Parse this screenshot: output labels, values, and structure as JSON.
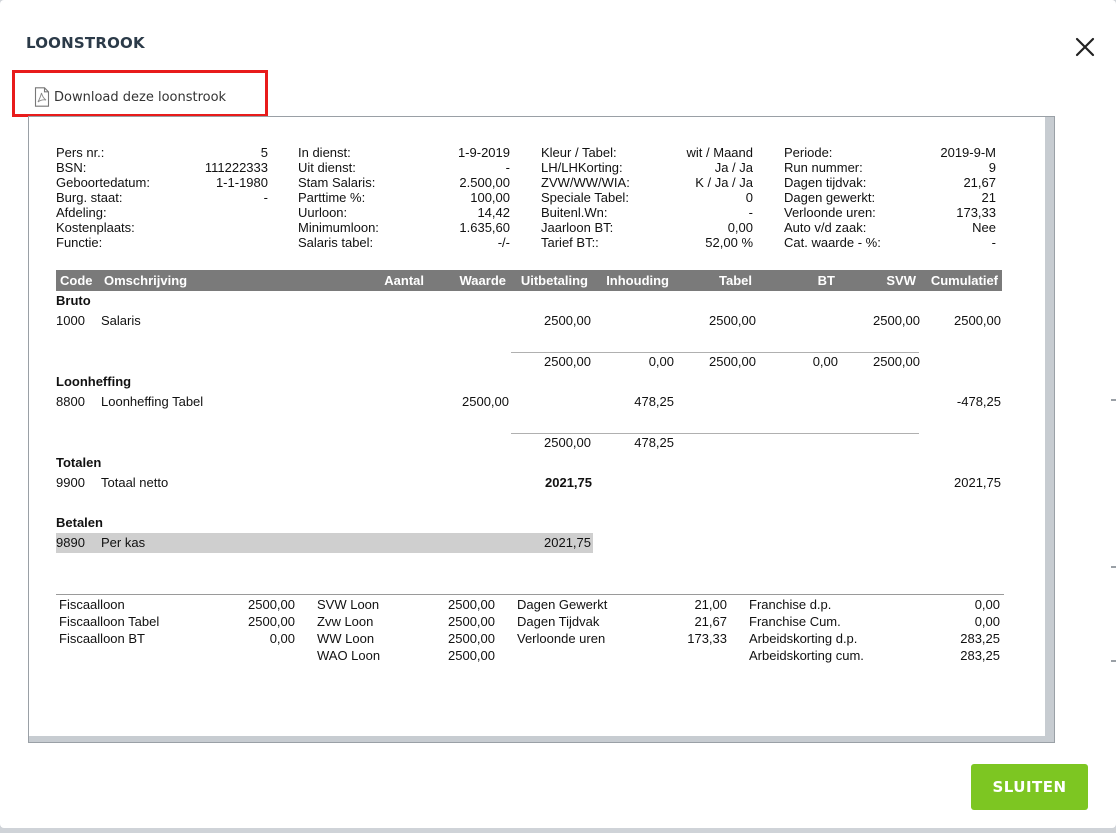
{
  "modal": {
    "title": "LOONSTROOK",
    "download_label": "Download deze loonstrook",
    "close_label": "Sluiten",
    "button_label": "SLUITEN",
    "accent_color": "#7dc622",
    "highlight_color": "#e81b1b"
  },
  "info": {
    "col1": [
      {
        "label": "Pers nr.:",
        "value": "5"
      },
      {
        "label": "BSN:",
        "value": "111222333"
      },
      {
        "label": "Geboortedatum:",
        "value": "1-1-1980"
      },
      {
        "label": "Burg. staat:",
        "value": "-"
      },
      {
        "label": "Afdeling:",
        "value": ""
      },
      {
        "label": "Kostenplaats:",
        "value": ""
      },
      {
        "label": "Functie:",
        "value": ""
      }
    ],
    "col2": [
      {
        "label": "In dienst:",
        "value": "1-9-2019"
      },
      {
        "label": "Uit dienst:",
        "value": "-"
      },
      {
        "label": "Stam Salaris:",
        "value": "2.500,00"
      },
      {
        "label": "Parttime %:",
        "value": "100,00"
      },
      {
        "label": "Uurloon:",
        "value": "14,42"
      },
      {
        "label": "Minimumloon:",
        "value": "1.635,60"
      },
      {
        "label": "Salaris tabel:",
        "value": "-/-"
      }
    ],
    "col3": [
      {
        "label": "Kleur / Tabel:",
        "value": "wit / Maand"
      },
      {
        "label": "LH/LHKorting:",
        "value": "Ja / Ja"
      },
      {
        "label": "ZVW/WW/WIA:",
        "value": "K / Ja / Ja"
      },
      {
        "label": "Speciale Tabel:",
        "value": "0"
      },
      {
        "label": "Buitenl.Wn:",
        "value": "-"
      },
      {
        "label": "Jaarloon BT:",
        "value": "0,00"
      },
      {
        "label": "Tarief BT::",
        "value": "52,00 %"
      }
    ],
    "col4": [
      {
        "label": "Periode:",
        "value": "2019-9-M"
      },
      {
        "label": "Run nummer:",
        "value": "9"
      },
      {
        "label": "Dagen tijdvak:",
        "value": "21,67"
      },
      {
        "label": "Dagen gewerkt:",
        "value": "21"
      },
      {
        "label": "Verloonde uren:",
        "value": "173,33"
      },
      {
        "label": "Auto v/d zaak:",
        "value": "Nee"
      },
      {
        "label": "Cat. waarde - %:",
        "value": "-"
      }
    ]
  },
  "table": {
    "headers": {
      "code": "Code",
      "omschrijving": "Omschrijving",
      "aantal": "Aantal",
      "waarde": "Waarde",
      "uitbetaling": "Uitbetaling",
      "inhouding": "Inhouding",
      "tabel": "Tabel",
      "bt": "BT",
      "svw": "SVW",
      "cumulatief": "Cumulatief"
    },
    "bruto": {
      "title": "Bruto",
      "row": {
        "code": "1000",
        "desc": "Salaris",
        "uitbetaling": "2500,00",
        "tabel": "2500,00",
        "svw": "2500,00",
        "cumulatief": "2500,00"
      },
      "sub": {
        "uitbetaling": "2500,00",
        "inhouding": "0,00",
        "tabel": "2500,00",
        "bt": "0,00",
        "svw": "2500,00"
      }
    },
    "loonheffing": {
      "title": "Loonheffing",
      "row": {
        "code": "8800",
        "desc": "Loonheffing Tabel",
        "waarde": "2500,00",
        "inhouding": "478,25",
        "cumulatief": "-478,25"
      },
      "sub": {
        "uitbetaling": "2500,00",
        "inhouding": "478,25"
      }
    },
    "totalen": {
      "title": "Totalen",
      "row": {
        "code": "9900",
        "desc": "Totaal netto",
        "uitbetaling": "2021,75",
        "cumulatief": "2021,75"
      }
    },
    "betalen": {
      "title": "Betalen",
      "row": {
        "code": "9890",
        "desc": "Per kas",
        "uitbetaling": "2021,75"
      }
    }
  },
  "footer": {
    "col1": [
      {
        "label": "Fiscaalloon",
        "value": "2500,00"
      },
      {
        "label": "Fiscaalloon Tabel",
        "value": "2500,00"
      },
      {
        "label": "Fiscaalloon BT",
        "value": "0,00"
      }
    ],
    "col2": [
      {
        "label": "SVW Loon",
        "value": "2500,00"
      },
      {
        "label": "Zvw Loon",
        "value": "2500,00"
      },
      {
        "label": "WW Loon",
        "value": "2500,00"
      },
      {
        "label": "WAO Loon",
        "value": "2500,00"
      }
    ],
    "col3": [
      {
        "label": "Dagen Gewerkt",
        "value": "21,00"
      },
      {
        "label": "Dagen Tijdvak",
        "value": "21,67"
      },
      {
        "label": "Verloonde uren",
        "value": "173,33"
      }
    ],
    "col4": [
      {
        "label": "Franchise d.p.",
        "value": "0,00"
      },
      {
        "label": "Franchise Cum.",
        "value": "0,00"
      },
      {
        "label": "Arbeidskorting d.p.",
        "value": "283,25"
      },
      {
        "label": "Arbeidskorting cum.",
        "value": "283,25"
      }
    ]
  }
}
